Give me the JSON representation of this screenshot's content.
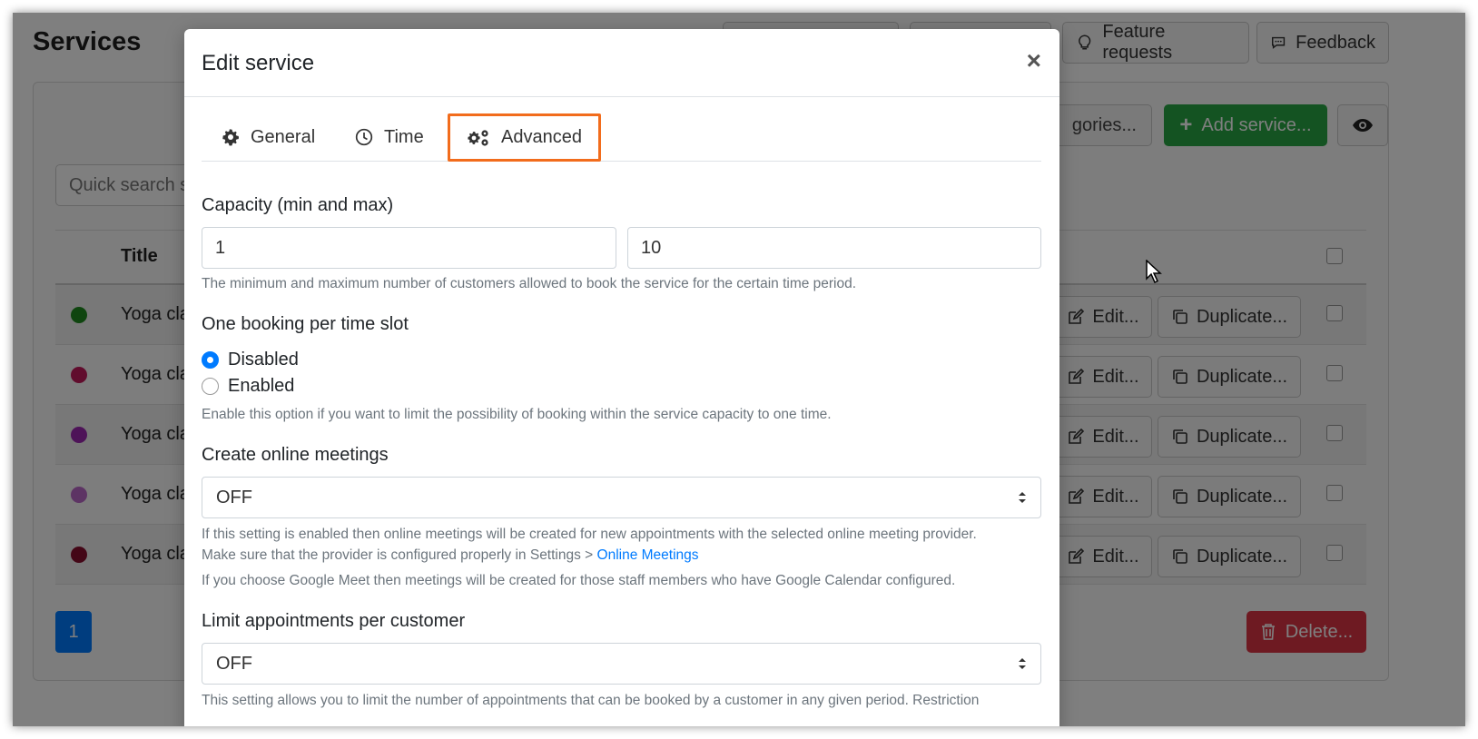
{
  "page": {
    "title": "Services",
    "top_buttons": {
      "feature_requests": "Feature requests",
      "feedback": "Feedback"
    },
    "categories_button": "gories...",
    "add_service_button": "Add service...",
    "search_placeholder": "Quick search s",
    "table": {
      "title_header": "Title",
      "rows": [
        {
          "title": "Yoga cla",
          "color": "#1e8a1e",
          "edit": "Edit...",
          "duplicate": "Duplicate..."
        },
        {
          "title": "Yoga cla",
          "color": "#c2185b",
          "edit": "Edit...",
          "duplicate": "Duplicate..."
        },
        {
          "title": "Yoga cla",
          "color": "#9c27b0",
          "edit": "Edit...",
          "duplicate": "Duplicate..."
        },
        {
          "title": "Yoga cla",
          "color": "#ba68c8",
          "edit": "Edit...",
          "duplicate": "Duplicate..."
        },
        {
          "title": "Yoga cla",
          "color": "#880e2f",
          "edit": "Edit...",
          "duplicate": "Duplicate..."
        }
      ]
    },
    "pagination": {
      "current": "1"
    },
    "delete_button": "Delete..."
  },
  "modal": {
    "title": "Edit service",
    "close": "×",
    "tabs": [
      {
        "label": "General",
        "icon": "gear-icon"
      },
      {
        "label": "Time",
        "icon": "clock-icon"
      },
      {
        "label": "Advanced",
        "icon": "gears-icon",
        "active": true
      }
    ],
    "capacity": {
      "label": "Capacity (min and max)",
      "min": "1",
      "max": "10",
      "help": "The minimum and maximum number of customers allowed to book the service for the certain time period."
    },
    "one_booking": {
      "label": "One booking per time slot",
      "options": [
        {
          "label": "Disabled",
          "checked": true
        },
        {
          "label": "Enabled",
          "checked": false
        }
      ],
      "help": "Enable this option if you want to limit the possibility of booking within the service capacity to one time."
    },
    "online_meetings": {
      "label": "Create online meetings",
      "value": "OFF",
      "help_line1": "If this setting is enabled then online meetings will be created for new appointments with the selected online meeting provider.",
      "help_line2_prefix": "Make sure that the provider is configured properly in Settings > ",
      "help_link": "Online Meetings",
      "help_line3": "If you choose Google Meet then meetings will be created for those staff members who have Google Calendar configured."
    },
    "limit_appointments": {
      "label": "Limit appointments per customer",
      "value": "OFF",
      "help": "This setting allows you to limit the number of appointments that can be booked by a customer in any given period. Restriction"
    }
  },
  "colors": {
    "accent": "#007bff",
    "highlight": "#f26c1c",
    "success": "#28a745",
    "danger": "#dc3545"
  }
}
